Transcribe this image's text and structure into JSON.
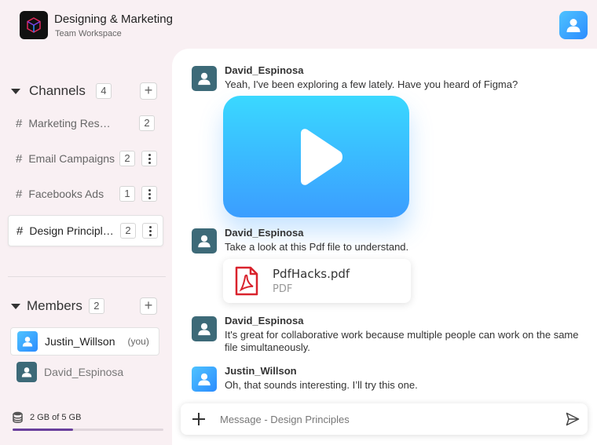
{
  "workspace": {
    "title": "Designing & Marketing",
    "subtitle": "Team Workspace"
  },
  "channels": {
    "title": "Channels",
    "count": "4",
    "items": [
      {
        "hash": "#",
        "name": "Marketing Research",
        "count": "2"
      },
      {
        "hash": "#",
        "name": "Email Campaigns",
        "count": "2"
      },
      {
        "hash": "#",
        "name": "Facebooks Ads",
        "count": "1"
      },
      {
        "hash": "#",
        "name": "Design Principles",
        "count": "2"
      }
    ]
  },
  "members": {
    "title": "Members",
    "count": "2",
    "items": [
      {
        "name": "Justin_Willson",
        "tag": "(you)"
      },
      {
        "name": "David_Espinosa"
      }
    ]
  },
  "storage": {
    "label": "2 GB of 5 GB",
    "used_fraction": 0.4
  },
  "messages": [
    {
      "sender": "David_Espinosa",
      "text": "Yeah, I've been exploring a few lately. Have you heard of Figma?"
    },
    {
      "sender": "David_Espinosa",
      "text": "Take a look at this Pdf file to understand."
    },
    {
      "sender": "David_Espinosa",
      "text": "It's great for collaborative work because multiple people can work on the same file simultaneously."
    },
    {
      "sender": "Justin_Willson",
      "text": "Oh, that sounds interesting. I’ll try this one."
    }
  ],
  "attachment": {
    "name": "PdfHacks.pdf",
    "type": "PDF"
  },
  "composer": {
    "placeholder": "Message - Design Principles"
  },
  "icons": {
    "workspace_logo": "cube-logo",
    "user": "user-icon",
    "video": "play-icon",
    "pdf": "pdf-file-icon",
    "storage": "database-icon",
    "send": "send-icon"
  },
  "colors": {
    "accent_blue": "#2b8cff",
    "avatar_teal": "#3d6a78",
    "storage_fill": "#6a3f9c",
    "pdf_red": "#d9232d"
  }
}
